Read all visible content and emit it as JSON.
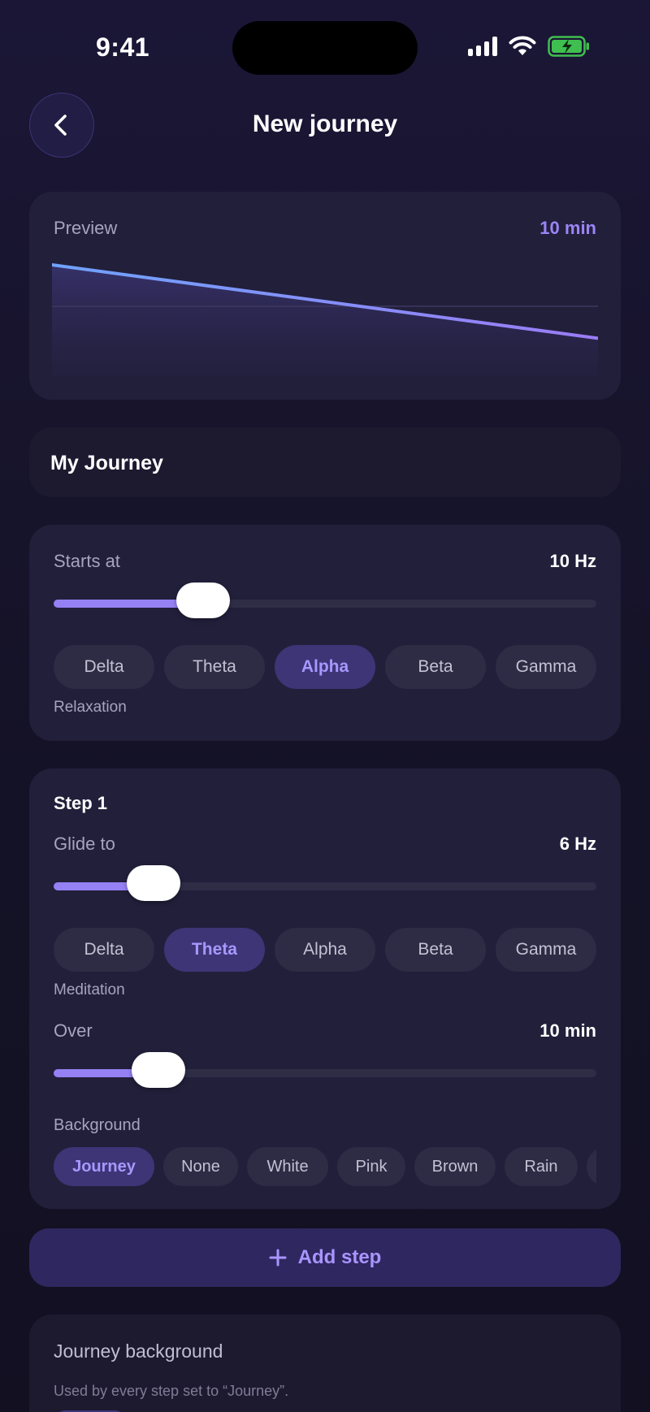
{
  "status": {
    "time": "9:41"
  },
  "header": {
    "title": "New journey"
  },
  "preview": {
    "label": "Preview",
    "duration": "10 min",
    "colors": {
      "line_start": "#6fa3ff",
      "line_end": "#9b7cf5"
    }
  },
  "name_field": {
    "value": "My Journey"
  },
  "start": {
    "label": "Starts at",
    "value": "10 Hz",
    "level": 0.25,
    "bands": [
      "Delta",
      "Theta",
      "Alpha",
      "Beta",
      "Gamma"
    ],
    "selected_band": "Alpha",
    "band_description": "Relaxation"
  },
  "step1": {
    "title": "Step 1",
    "glide_label": "Glide to",
    "glide_value": "6 Hz",
    "glide_level": 0.15,
    "bands": [
      "Delta",
      "Theta",
      "Alpha",
      "Beta",
      "Gamma"
    ],
    "selected_band": "Theta",
    "band_description": "Meditation",
    "over_label": "Over",
    "over_value": "10 min",
    "over_level": 0.16,
    "background_label": "Background",
    "backgrounds": [
      "Journey",
      "None",
      "White",
      "Pink",
      "Brown",
      "Rain"
    ],
    "selected_background": "Journey"
  },
  "add_step": {
    "label": "Add step"
  },
  "journey_background": {
    "title": "Journey background",
    "description": "Used by every step set to “Journey”."
  },
  "colors": {
    "accent": "#9b85f5",
    "card": "#221f3b",
    "background": "#17142c"
  }
}
